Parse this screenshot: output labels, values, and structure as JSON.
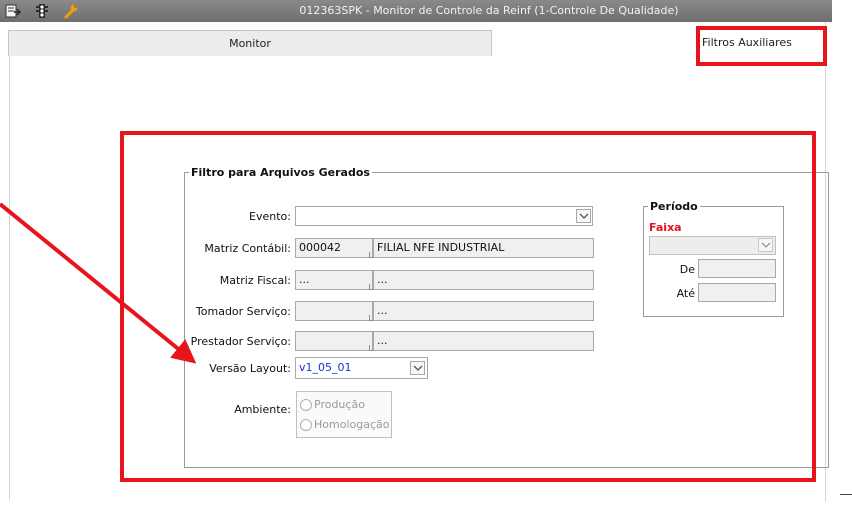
{
  "window": {
    "title": "012363SPK - Monitor de Controle da Reinf (1-Controle De Qualidade)",
    "icons": [
      "export-icon",
      "traffic-light-icon",
      "wrench-icon"
    ]
  },
  "tabs": [
    {
      "label": "Monitor",
      "active": false
    },
    {
      "label": "Filtros Auxiliares",
      "active": true
    }
  ],
  "filtro": {
    "legend": "Filtro para Arquivos Gerados",
    "evento": {
      "label": "Evento:",
      "value": ""
    },
    "matriz_contabil": {
      "label": "Matriz Contábil:",
      "code": "000042",
      "name": "FILIAL NFE INDUSTRIAL"
    },
    "matriz_fiscal": {
      "label": "Matriz Fiscal:",
      "code": "...",
      "name": "..."
    },
    "tomador": {
      "label": "Tomador Serviço:",
      "code": "",
      "name": "..."
    },
    "prestador": {
      "label": "Prestador Serviço:",
      "code": "",
      "name": "..."
    },
    "versao": {
      "label": "Versão Layout:",
      "value": "v1_05_01"
    },
    "ambiente": {
      "label": "Ambiente:",
      "options": [
        "Produção",
        "Homologação"
      ]
    }
  },
  "periodo": {
    "legend": "Período",
    "faixa_label": "Faixa",
    "faixa_value": "",
    "de_label": "De",
    "de_value": "",
    "ate_label": "Até",
    "ate_value": ""
  },
  "colors": {
    "highlight": "#e8141c",
    "faixa_text": "#e0141e",
    "versao_text": "#1a2fd0",
    "titlebar": "#7a7a7a"
  }
}
